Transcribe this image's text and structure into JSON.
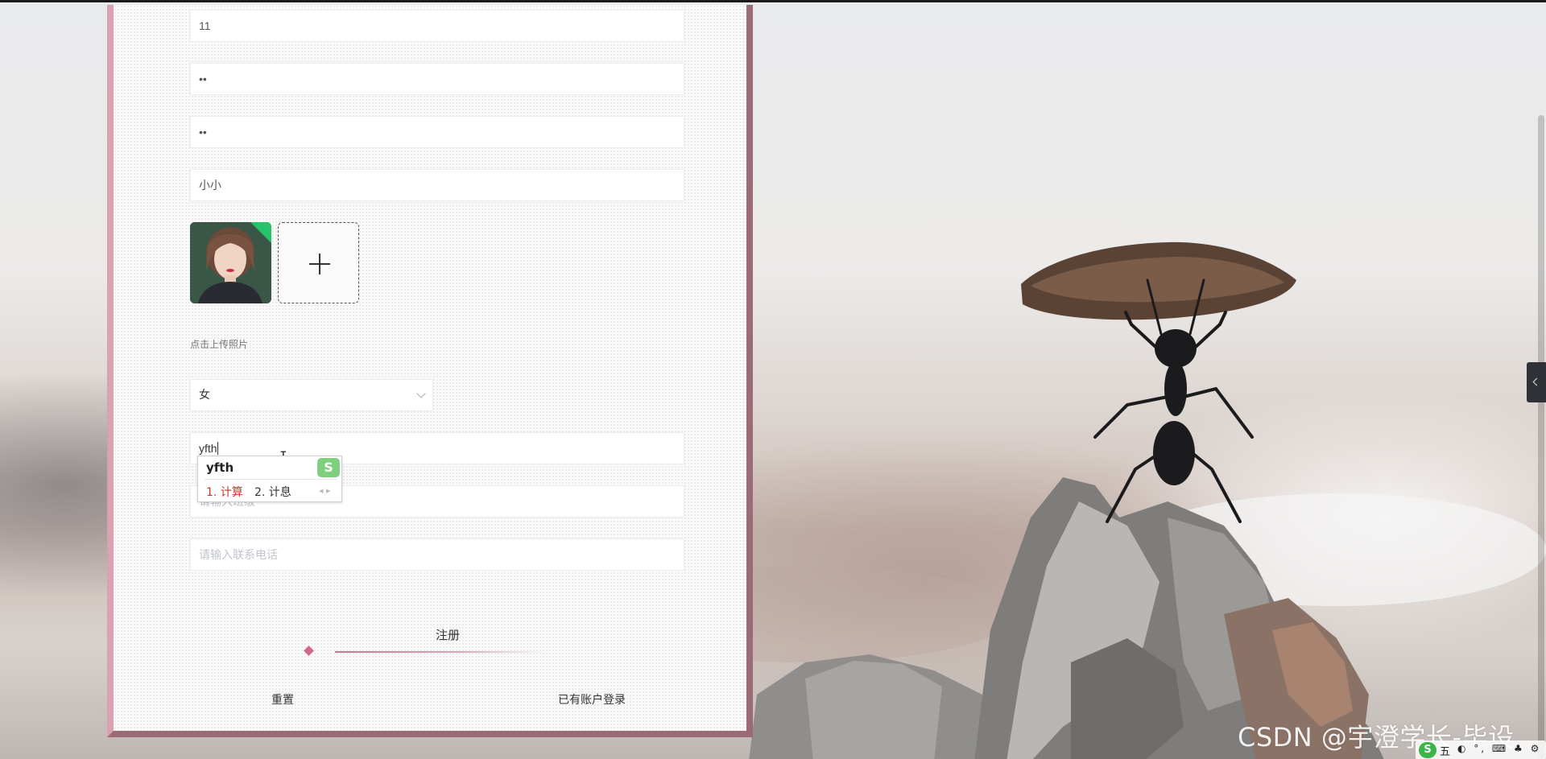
{
  "form": {
    "field_values": {
      "account": "11",
      "password": "••",
      "confirm_password": "••",
      "name": "小小"
    },
    "upload_hint": "点击上传照片",
    "gender_select": {
      "selected": "女"
    },
    "class_input": {
      "value": "yfth",
      "placeholder": "请输入班级"
    },
    "phone_input": {
      "placeholder": "请输入联系电话"
    },
    "register_label": "注册",
    "reset_label": "重置",
    "login_link_label": "已有账户登录"
  },
  "ime_popup": {
    "composition": "yfth",
    "candidate_1": "1. 计算",
    "candidate_2": "2. 计息",
    "nav": "◂ ▸",
    "logo": "S"
  },
  "watermark": "CSDN @宇澄学长-毕设",
  "taskbar": {
    "logo": "S",
    "mode": "五",
    "icons": "◐ °, ⌨ ♣ ⚙"
  },
  "colors": {
    "panel_border_left": "#d9a2b0",
    "panel_border_right": "#9c6b78",
    "accent_diamond": "#d06a87",
    "ime_candidate_active": "#c0392b"
  }
}
